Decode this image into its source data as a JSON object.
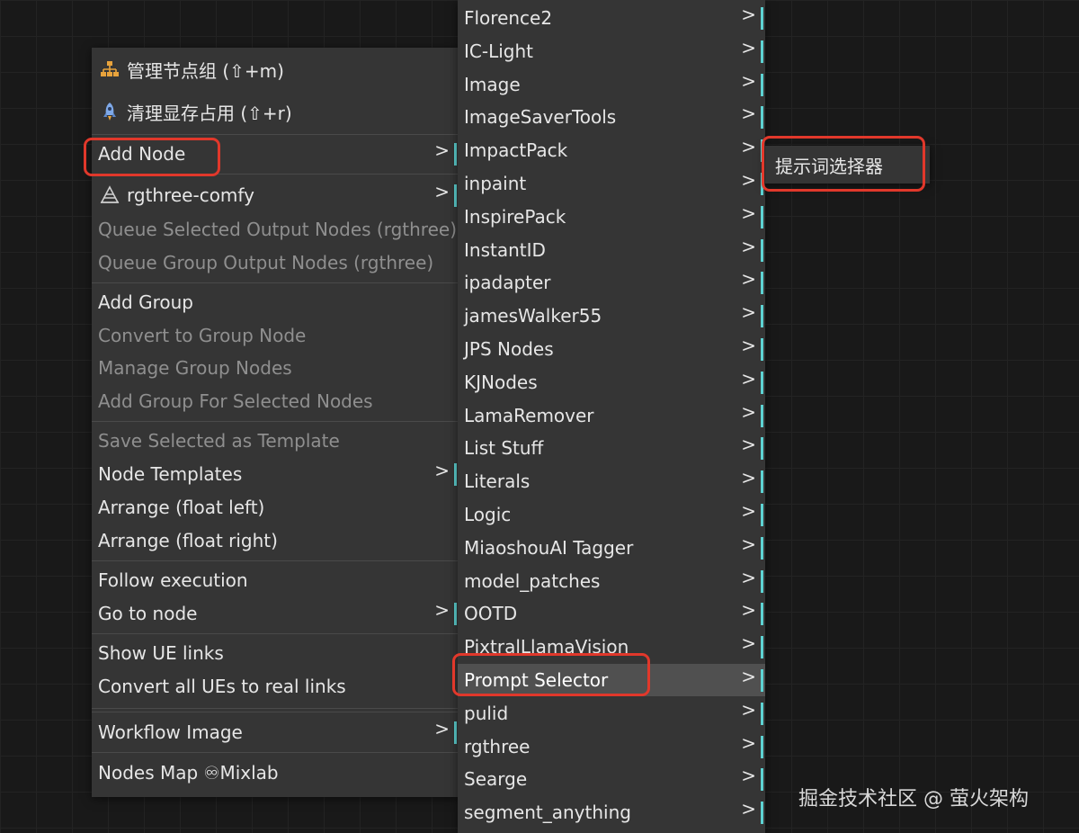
{
  "main_menu": {
    "items": [
      {
        "label": "管理节点组 (⇧+m)",
        "icon": "node-group-icon"
      },
      {
        "label": "清理显存占用 (⇧+r)",
        "icon": "rocket-icon"
      },
      {
        "label": "Add Node",
        "submenu_arrow": ">"
      },
      {
        "label": "rgthree-comfy",
        "icon": "rgthree-icon",
        "submenu_arrow": ">"
      },
      {
        "label": "Queue Selected Output Nodes (rgthree)",
        "disabled": true
      },
      {
        "label": "Queue Group Output Nodes (rgthree)",
        "disabled": true
      },
      {
        "label": "Add Group"
      },
      {
        "label": "Convert to Group Node",
        "disabled": true
      },
      {
        "label": "Manage Group Nodes",
        "disabled": true
      },
      {
        "label": "Add Group For Selected Nodes",
        "disabled": true
      },
      {
        "label": "Save Selected as Template",
        "disabled": true
      },
      {
        "label": "Node Templates",
        "submenu_arrow": ">"
      },
      {
        "label": "Arrange (float left)"
      },
      {
        "label": "Arrange (float right)"
      },
      {
        "label": "Follow execution"
      },
      {
        "label": "Go to node",
        "submenu_arrow": ">"
      },
      {
        "label": "Show UE links"
      },
      {
        "label": "Convert all UEs to real links"
      },
      {
        "label": "Workflow Image",
        "submenu_arrow": ">"
      },
      {
        "label": "Nodes Map ♾Mixlab"
      }
    ]
  },
  "sub_menu": {
    "arrow": ">",
    "items": [
      "Florence2",
      "IC-Light",
      "Image",
      "ImageSaverTools",
      "ImpactPack",
      "inpaint",
      "InspirePack",
      "InstantID",
      "ipadapter",
      "jamesWalker55",
      "JPS Nodes",
      "KJNodes",
      "LamaRemover",
      "List Stuff",
      "Literals",
      "Logic",
      "MiaoshouAI Tagger",
      "model_patches",
      "OOTD",
      "PixtralLlamaVision",
      "Prompt Selector",
      "pulid",
      "rgthree",
      "Searge",
      "segment_anything"
    ],
    "highlighted": "Prompt Selector"
  },
  "third_menu": {
    "items": [
      "提示词选择器"
    ]
  },
  "watermark": "掘金技术社区 @ 萤火架构",
  "colors": {
    "menu_bg": "#353535",
    "highlight_bg": "#505050",
    "submenu_indicator": "#5dd3d3",
    "annotation_red": "#e1382b",
    "disabled_text": "#8f8f8f"
  }
}
